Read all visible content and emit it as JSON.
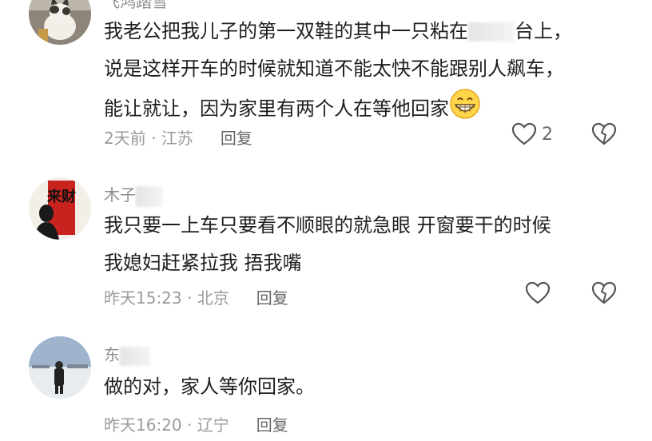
{
  "comments": [
    {
      "username": "飞鸿踏雪",
      "text_lines": [
        "我老公把我儿子的第一双鞋的其中一只粘在",
        "台上，",
        "说是这样开车的时候就知道不能太快不能跟别人飙车，",
        "能让就让，因为家里有两个人在等他回家"
      ],
      "emoji": "grinning-face-emoji",
      "time": "2天前",
      "location": "江苏",
      "reply_label": "回复",
      "like_count": "2"
    },
    {
      "username": "木子",
      "avatar_text": "来财",
      "text_lines": [
        "我只要一上车只要看不顺眼的就急眼 开窗要干的时候",
        "我媳妇赶紧拉我 捂我嘴"
      ],
      "time": "昨天15:23",
      "location": "北京",
      "reply_label": "回复",
      "like_count": ""
    },
    {
      "username": "东",
      "text_lines": [
        "做的对，家人等你回家。"
      ],
      "time": "昨天16:20",
      "location": "辽宁",
      "reply_label": "回复",
      "like_count": ""
    }
  ],
  "meta_separator": " · ",
  "colors": {
    "accent_red": "#c8231f",
    "meta_gray": "#9a9a9a"
  }
}
